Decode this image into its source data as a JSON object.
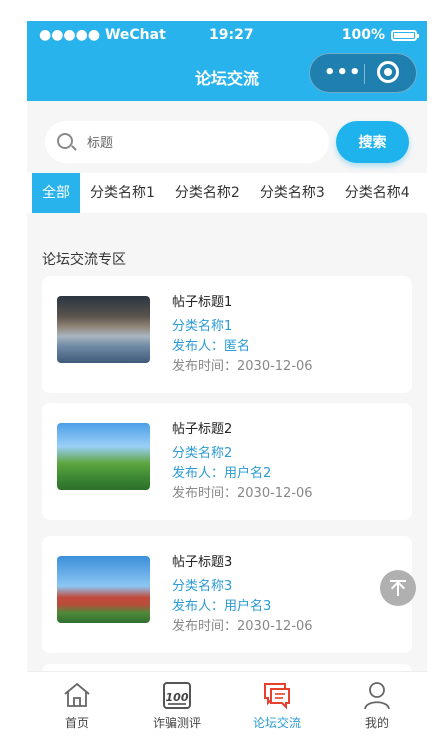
{
  "status_bar": {
    "carrier": "●●●●● WeChat",
    "time": "19:27",
    "battery": "100%"
  },
  "navbar": {
    "title": "论坛交流",
    "capsule_menu": "•••"
  },
  "search": {
    "placeholder": "标题",
    "button": "搜索"
  },
  "categories": [
    "全部",
    "分类名称1",
    "分类名称2",
    "分类名称3",
    "分类名称4"
  ],
  "section_title": "论坛交流专区",
  "posts": [
    {
      "title": "帖子标题1",
      "category": "分类名称1",
      "author": "发布人：匿名",
      "date": "发布时间：2030-12-06"
    },
    {
      "title": "帖子标题2",
      "category": "分类名称2",
      "author": "发布人：用户名2",
      "date": "发布时间：2030-12-06"
    },
    {
      "title": "帖子标题3",
      "category": "分类名称3",
      "author": "发布人：用户名3",
      "date": "发布时间：2030-12-06"
    }
  ],
  "tabbar": [
    {
      "label": "首页",
      "icon": "home-icon"
    },
    {
      "label": "诈骗测评",
      "icon": "score-100-icon"
    },
    {
      "label": "论坛交流",
      "icon": "chat-bubble-icon"
    },
    {
      "label": "我的",
      "icon": "person-icon"
    }
  ],
  "colors": {
    "primary": "#28b3ec",
    "link": "#2a9bd4",
    "background": "#f6f6f6",
    "tab_active": "#e7402f"
  }
}
